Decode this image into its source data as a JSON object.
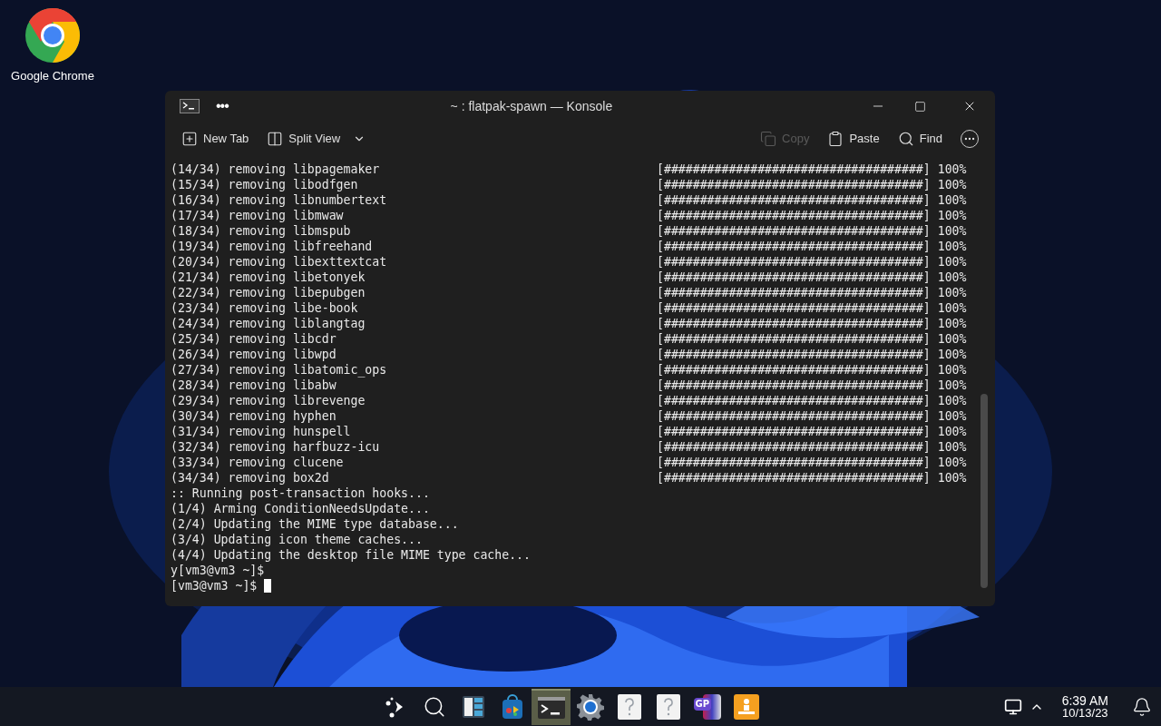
{
  "desktop_icons": [
    {
      "label": "Google Chrome"
    }
  ],
  "window": {
    "title": "~ : flatpak-spawn — Konsole",
    "menu_glyph": "•••"
  },
  "toolbar": {
    "left": [
      {
        "label": "New Tab",
        "kind": "newtab"
      },
      {
        "label": "Split View",
        "kind": "split"
      }
    ],
    "right": [
      {
        "label": "Copy",
        "kind": "copy",
        "disabled": true
      },
      {
        "label": "Paste",
        "kind": "paste",
        "disabled": false
      },
      {
        "label": "Find",
        "kind": "find",
        "disabled": false
      }
    ]
  },
  "terminal": {
    "lines": [
      {
        "kind": "progress",
        "text": "(14/34) removing libpagemaker",
        "bar": "[####################################]",
        "percent": "100%"
      },
      {
        "kind": "progress",
        "text": "(15/34) removing libodfgen",
        "bar": "[####################################]",
        "percent": "100%"
      },
      {
        "kind": "progress",
        "text": "(16/34) removing libnumbertext",
        "bar": "[####################################]",
        "percent": "100%"
      },
      {
        "kind": "progress",
        "text": "(17/34) removing libmwaw",
        "bar": "[####################################]",
        "percent": "100%"
      },
      {
        "kind": "progress",
        "text": "(18/34) removing libmspub",
        "bar": "[####################################]",
        "percent": "100%"
      },
      {
        "kind": "progress",
        "text": "(19/34) removing libfreehand",
        "bar": "[####################################]",
        "percent": "100%"
      },
      {
        "kind": "progress",
        "text": "(20/34) removing libexttextcat",
        "bar": "[####################################]",
        "percent": "100%"
      },
      {
        "kind": "progress",
        "text": "(21/34) removing libetonyek",
        "bar": "[####################################]",
        "percent": "100%"
      },
      {
        "kind": "progress",
        "text": "(22/34) removing libepubgen",
        "bar": "[####################################]",
        "percent": "100%"
      },
      {
        "kind": "progress",
        "text": "(23/34) removing libe-book",
        "bar": "[####################################]",
        "percent": "100%"
      },
      {
        "kind": "progress",
        "text": "(24/34) removing liblangtag",
        "bar": "[####################################]",
        "percent": "100%"
      },
      {
        "kind": "progress",
        "text": "(25/34) removing libcdr",
        "bar": "[####################################]",
        "percent": "100%"
      },
      {
        "kind": "progress",
        "text": "(26/34) removing libwpd",
        "bar": "[####################################]",
        "percent": "100%"
      },
      {
        "kind": "progress",
        "text": "(27/34) removing libatomic_ops",
        "bar": "[####################################]",
        "percent": "100%"
      },
      {
        "kind": "progress",
        "text": "(28/34) removing libabw",
        "bar": "[####################################]",
        "percent": "100%"
      },
      {
        "kind": "progress",
        "text": "(29/34) removing librevenge",
        "bar": "[####################################]",
        "percent": "100%"
      },
      {
        "kind": "progress",
        "text": "(30/34) removing hyphen",
        "bar": "[####################################]",
        "percent": "100%"
      },
      {
        "kind": "progress",
        "text": "(31/34) removing hunspell",
        "bar": "[####################################]",
        "percent": "100%"
      },
      {
        "kind": "progress",
        "text": "(32/34) removing harfbuzz-icu",
        "bar": "[####################################]",
        "percent": "100%"
      },
      {
        "kind": "progress",
        "text": "(33/34) removing clucene",
        "bar": "[####################################]",
        "percent": "100%"
      },
      {
        "kind": "progress",
        "text": "(34/34) removing box2d",
        "bar": "[####################################]",
        "percent": "100%"
      },
      {
        "kind": "text",
        "text": ":: Running post-transaction hooks..."
      },
      {
        "kind": "text",
        "text": "(1/4) Arming ConditionNeedsUpdate..."
      },
      {
        "kind": "text",
        "text": "(2/4) Updating the MIME type database..."
      },
      {
        "kind": "text",
        "text": "(3/4) Updating icon theme caches..."
      },
      {
        "kind": "text",
        "text": "(4/4) Updating the desktop file MIME type cache..."
      },
      {
        "kind": "text",
        "text": "y[vm3@vm3 ~]$"
      },
      {
        "kind": "prompt",
        "text": "[vm3@vm3 ~]$"
      }
    ]
  },
  "taskbar": {
    "apps": [
      {
        "kind": "launcher",
        "selected": false
      },
      {
        "kind": "search",
        "selected": false
      },
      {
        "kind": "widgets",
        "selected": false
      },
      {
        "kind": "store",
        "selected": false
      },
      {
        "kind": "terminal",
        "selected": true
      },
      {
        "kind": "settings",
        "selected": false
      },
      {
        "kind": "unknown",
        "selected": false
      },
      {
        "kind": "unknown",
        "selected": false
      },
      {
        "kind": "gp",
        "selected": false,
        "label": "GP"
      },
      {
        "kind": "orange",
        "selected": false
      }
    ],
    "clock": {
      "time": "6:39 AM",
      "date": "10/13/23"
    }
  }
}
